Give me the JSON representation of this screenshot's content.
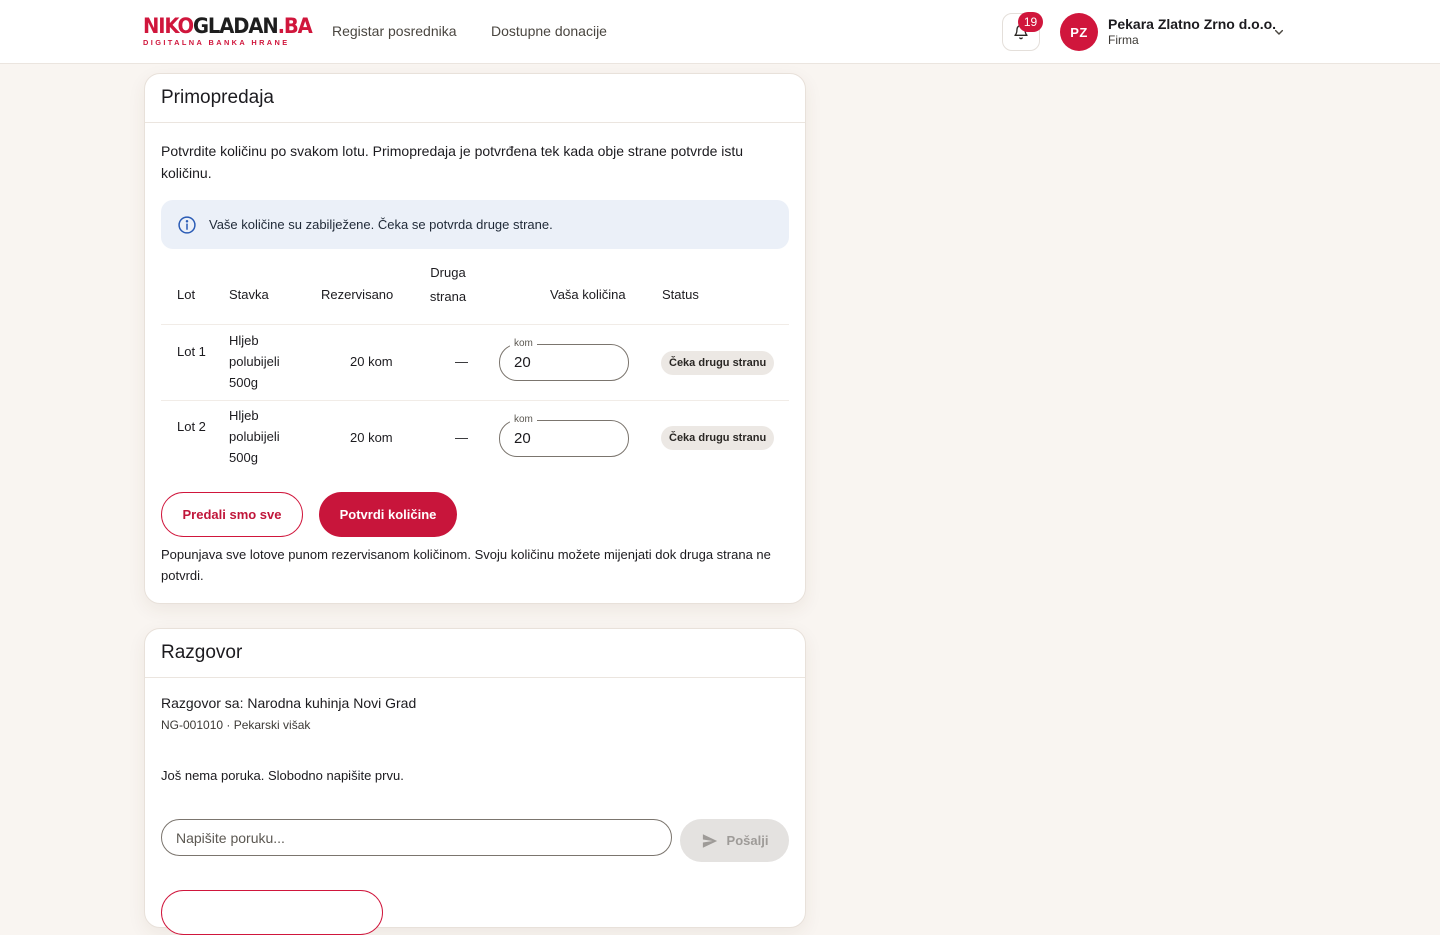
{
  "brand": {
    "logo_part1": "NIKO",
    "logo_part2": "GLADAN",
    "logo_part3": ".BA",
    "tagline": "DIGITALNA BANKA HRANE",
    "color": "#d0163c"
  },
  "nav": {
    "links": [
      "Registar posrednika",
      "Dostupne donacije"
    ]
  },
  "notifications": {
    "count": "19",
    "icon": "bell-icon"
  },
  "user": {
    "initials": "PZ",
    "name": "Pekara Zlatno Zrno d.o.o.",
    "role": "Firma"
  },
  "handover": {
    "title": "Primopredaja",
    "intro": "Potvrdite količinu po svakom lotu. Primopredaja je potvrđena tek kada obje strane potvrde istu količinu.",
    "info": "Vaše količine su zabilježene. Čeka se potvrda druge strane.",
    "columns": [
      "Lot",
      "Stavka",
      "Rezervisano",
      "Druga strana",
      "Vaša količina",
      "Status"
    ],
    "rows": [
      {
        "lot": "Lot 1",
        "item": "Hljeb polubijeli 500g",
        "reserved": "20 kom",
        "other": "—",
        "unit": "kom",
        "qty": "20",
        "status": "Čeka drugu stranu"
      },
      {
        "lot": "Lot 2",
        "item": "Hljeb polubijeli 500g",
        "reserved": "20 kom",
        "other": "—",
        "unit": "kom",
        "qty": "20",
        "status": "Čeka drugu stranu"
      }
    ],
    "btn_all": "Predali smo sve",
    "btn_confirm": "Potvrdi količine",
    "note": "Popunjava sve lotove punom rezervisanom količinom. Svoju količinu možete mijenjati dok druga strana ne potvrdi."
  },
  "chat": {
    "title": "Razgovor",
    "with": "Razgovor sa: Narodna kuhinja Novi Grad",
    "sub": "NG-001010 · Pekarski višak",
    "empty": "Još nema poruka. Slobodno napišite prvu.",
    "placeholder": "Napišite poruku...",
    "send": "Pošalji"
  }
}
